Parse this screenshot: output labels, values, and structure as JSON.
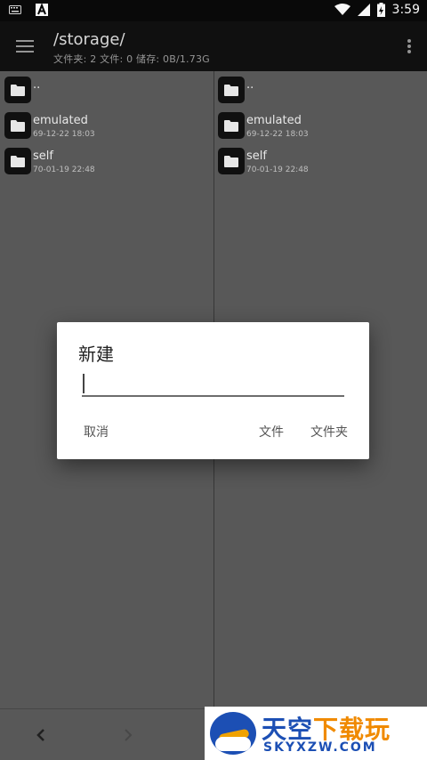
{
  "status_bar": {
    "time": "3:59",
    "icons": [
      "keyboard-icon",
      "a-badge-icon",
      "wifi-icon",
      "signal-icon",
      "battery-charging-icon"
    ]
  },
  "toolbar": {
    "path": "/storage/",
    "summary": "文件夹: 2  文件: 0  储存: 0B/1.73G",
    "menu_icon": "hamburger-menu-icon",
    "overflow_icon": "more-vert-icon"
  },
  "left_pane": {
    "items": [
      {
        "name": "..",
        "date": ""
      },
      {
        "name": "emulated",
        "date": "69-12-22 18:03"
      },
      {
        "name": "self",
        "date": "70-01-19 22:48"
      }
    ]
  },
  "right_pane": {
    "items": [
      {
        "name": "..",
        "date": ""
      },
      {
        "name": "emulated",
        "date": "69-12-22 18:03"
      },
      {
        "name": "self",
        "date": "70-01-19 22:48"
      }
    ]
  },
  "bottom_nav": {
    "back_icon": "chevron-left-icon",
    "forward_icon": "chevron-right-icon"
  },
  "dialog": {
    "title": "新建",
    "input_value": "",
    "cancel_label": "取消",
    "file_label": "文件",
    "folder_label": "文件夹"
  },
  "watermark": {
    "cn_blue": "天空",
    "cn_orange": "下载玩",
    "en": "SKYXZW.COM"
  },
  "colors": {
    "pane_bg": "#5b5b5b",
    "toolbar_bg": "#111111",
    "dialog_bg": "#ffffff",
    "watermark_blue": "#1c4fb4",
    "watermark_orange": "#f08a00"
  }
}
